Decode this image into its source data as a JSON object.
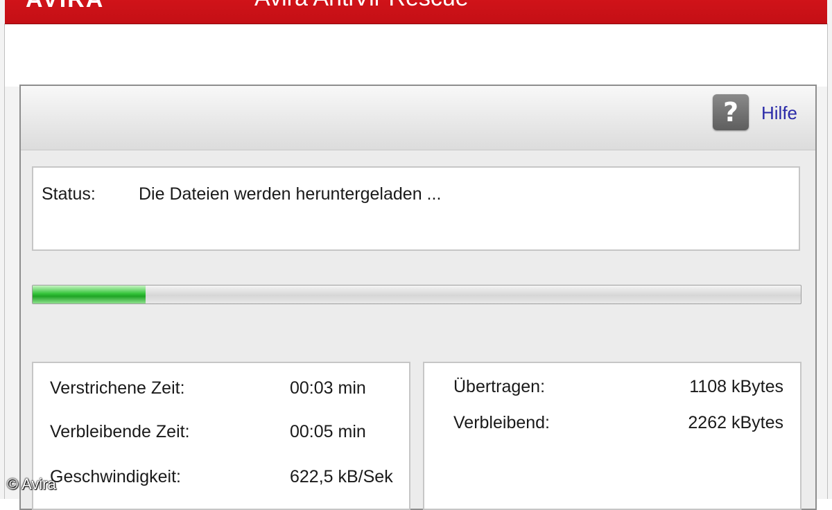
{
  "header": {
    "brand": "AVIRA",
    "title": "Avira AntiVir Rescue"
  },
  "toolbar": {
    "help_icon": "question-icon",
    "help_icon_glyph": "?",
    "help_label": "Hilfe"
  },
  "status": {
    "label": "Status:",
    "text": "Die Dateien werden heruntergeladen ..."
  },
  "progress": {
    "fraction": 0.147,
    "color": "#2eb834"
  },
  "stats_left": [
    {
      "label": "Verstrichene Zeit:",
      "value": "00:03 min"
    },
    {
      "label": "Verbleibende Zeit:",
      "value": "00:05 min"
    },
    {
      "label": "Geschwindigkeit:",
      "value": "622,5 kB/Sek"
    }
  ],
  "stats_right": [
    {
      "label": "Übertragen:",
      "value": "1108 kBytes"
    },
    {
      "label": "Verbleibend:",
      "value": "2262 kBytes"
    }
  ],
  "watermark": "© Avira",
  "colors": {
    "brand_red": "#c8141a",
    "link_blue": "#2a2aa8"
  }
}
